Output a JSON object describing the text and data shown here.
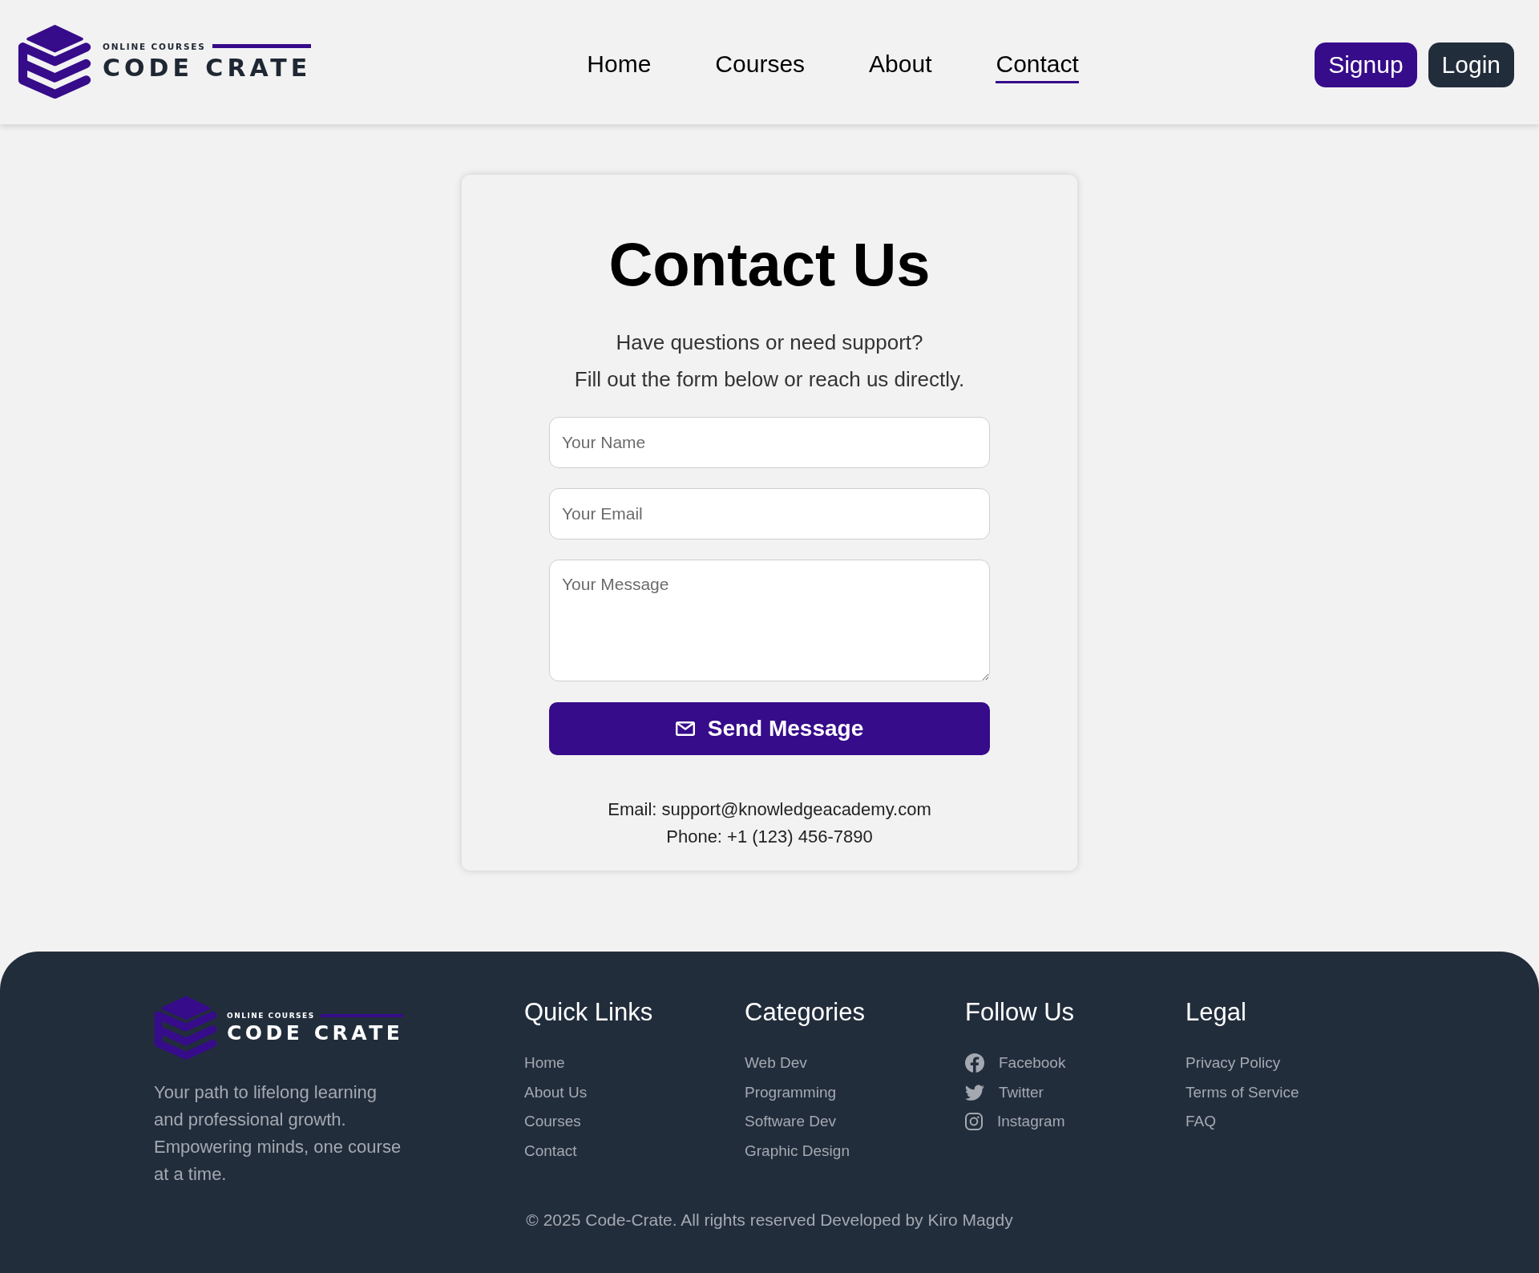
{
  "header": {
    "logo": {
      "tagline": "ONLINE COURSES",
      "name": "CODE CRATE"
    },
    "nav": [
      {
        "label": "Home",
        "selected": false
      },
      {
        "label": "Courses",
        "selected": false
      },
      {
        "label": "About",
        "selected": false
      },
      {
        "label": "Contact",
        "selected": true
      }
    ],
    "buttons": [
      {
        "label": "Signup",
        "kind": "primary"
      },
      {
        "label": "Login",
        "kind": "dark"
      }
    ]
  },
  "contact_card": {
    "title": "Contact Us",
    "intro": [
      "Have questions or need support?",
      "Fill out the form below or reach us directly."
    ],
    "fields": [
      {
        "kind": "input",
        "placeholder": "Your Name"
      },
      {
        "kind": "input",
        "placeholder": "Your Email"
      },
      {
        "kind": "textarea",
        "placeholder": "Your Message"
      }
    ],
    "submit_button": {
      "label": "Send Message"
    },
    "contact_lines": [
      "Email: support@knowledgeacademy.com",
      "Phone: +1 (123) 456-7890"
    ]
  },
  "footer": {
    "logo": {
      "tagline": "ONLINE COURSES",
      "name": "CODE CRATE"
    },
    "description": "Your path to lifelong learning and professional growth. Empowering minds, one course at a time.",
    "columns": [
      {
        "title": "Quick Links",
        "kind": "links",
        "links": [
          {
            "label": "Home"
          },
          {
            "label": "About Us"
          },
          {
            "label": "Courses"
          },
          {
            "label": "Contact"
          }
        ]
      },
      {
        "title": "Categories",
        "kind": "links",
        "links": [
          {
            "label": "Web Dev"
          },
          {
            "label": "Programming"
          },
          {
            "label": "Software Dev"
          },
          {
            "label": "Graphic Design"
          }
        ]
      },
      {
        "title": "Follow Us",
        "kind": "social",
        "links": [
          {
            "label": "Facebook"
          },
          {
            "label": "Twitter"
          },
          {
            "label": "Instagram"
          }
        ]
      },
      {
        "title": "Legal",
        "kind": "links",
        "links": [
          {
            "label": "Privacy Policy"
          },
          {
            "label": "Terms of Service"
          },
          {
            "label": "FAQ"
          }
        ]
      }
    ],
    "copyright": "© 2025 Code-Crate. All rights reserved Developed by Kiro Magdy"
  }
}
